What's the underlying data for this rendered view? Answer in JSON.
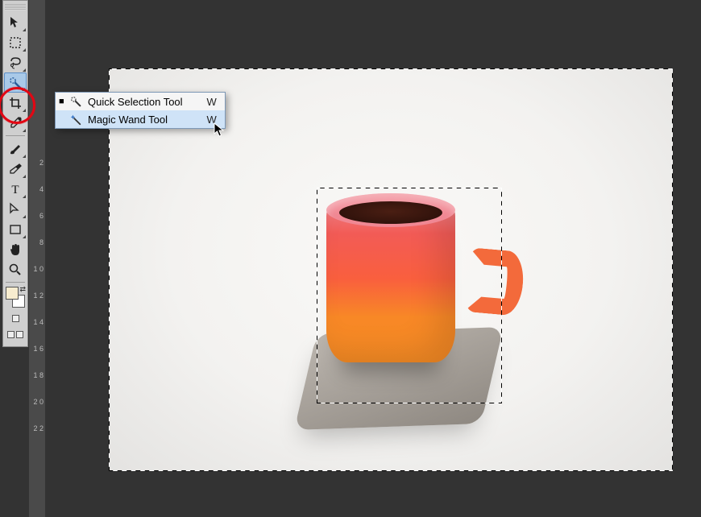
{
  "toolbox": {
    "tools": [
      {
        "name": "move-tool",
        "icon": "move",
        "flyout": true
      },
      {
        "name": "marquee-tool",
        "icon": "marquee",
        "flyout": true
      },
      {
        "name": "lasso-tool",
        "icon": "lasso",
        "flyout": true
      },
      {
        "name": "quick-selection-tool",
        "icon": "quickselect",
        "flyout": true,
        "active": true
      },
      {
        "name": "crop-tool",
        "icon": "crop",
        "flyout": true
      },
      {
        "name": "eyedropper-tool",
        "icon": "eyedropper",
        "flyout": true
      },
      {
        "sep": true
      },
      {
        "name": "brush-tool",
        "icon": "brush",
        "flyout": true
      },
      {
        "name": "eraser-tool",
        "icon": "eraser",
        "flyout": true
      },
      {
        "name": "type-tool",
        "icon": "type",
        "flyout": true
      },
      {
        "name": "path-tool",
        "icon": "path",
        "flyout": true
      },
      {
        "name": "shape-tool",
        "icon": "shape",
        "flyout": true
      },
      {
        "name": "hand-tool",
        "icon": "hand",
        "flyout": false
      },
      {
        "name": "zoom-tool",
        "icon": "zoom",
        "flyout": false
      },
      {
        "sep": true
      }
    ],
    "swatches": {
      "fg": "#f7eccf",
      "bg": "#ffffff"
    }
  },
  "ruler": {
    "ticks": [
      "2",
      "4",
      "6",
      "8",
      "1 0",
      "1 2",
      "1 4",
      "1 6",
      "1 8",
      "2 0",
      "2 2"
    ]
  },
  "flyout": {
    "items": [
      {
        "label": "Quick Selection Tool",
        "shortcut": "W",
        "icon": "quickselect",
        "selected": true,
        "hover": false
      },
      {
        "label": "Magic Wand Tool",
        "shortcut": "W",
        "icon": "wand",
        "selected": false,
        "hover": true
      }
    ]
  },
  "canvas": {
    "subject": "orange coffee mug on grey felt coaster",
    "selection": "background marching-ants with cup excluded"
  }
}
